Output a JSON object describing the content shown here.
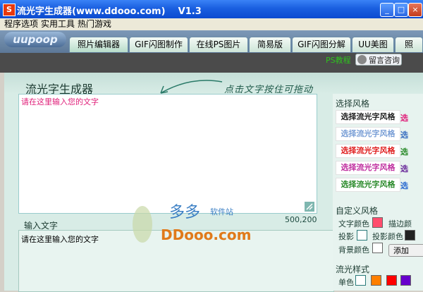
{
  "window": {
    "title": "流光字生成器(www.ddooo.com)    V1.3",
    "icon_letter": "S",
    "controls": [
      "_",
      "□",
      "×"
    ]
  },
  "menu": [
    "程序选项",
    "实用工具",
    "热门游戏"
  ],
  "logo_text": "uupoop",
  "tabs": [
    "照片编辑器",
    "GIF闪图制作",
    "在线PS图片",
    "简易版",
    "GIF闪图分解",
    "UU美图",
    "照"
  ],
  "sub_bar": {
    "ps_link": "PS教程",
    "message_button": "留言咨询"
  },
  "main": {
    "heading": "流光字生成器",
    "hint": "点击文字按住可拖动",
    "canvas_text": "请在这里输入您的文字",
    "coords": "500,200",
    "input_label": "输入文字",
    "input_value": "请在这里输入您的文字"
  },
  "right": {
    "style_title": "选择风格",
    "style_items": [
      "选择流光字风格",
      "选择流光字风格",
      "选择流光字风格",
      "选择流光字风格",
      "选择流光字风格"
    ],
    "style_items_right": [
      "选",
      "选",
      "选",
      "选",
      "选"
    ],
    "style_colors": [
      "#222222",
      "#7a9fd6",
      "#e02020",
      "#c030a0",
      "#2a8a2a"
    ],
    "custom_title": "自定义风格",
    "text_color_label": "文字颜色",
    "text_color": "#ff4d6d",
    "stroke_label": "描边颜",
    "shadow_label": "投影",
    "shadow_color_label": "投影颜色",
    "bg_color_label": "背景颜色",
    "add_button": "添加",
    "flow_title": "流光样式",
    "single_color_label": "单色",
    "flow_swatches": [
      "#ffffff",
      "#ff7f00",
      "#ff0000",
      "#6600cc",
      "#00aaff"
    ]
  },
  "watermark": {
    "top": "多多 软件站",
    "bottom": "DDooo.com"
  }
}
